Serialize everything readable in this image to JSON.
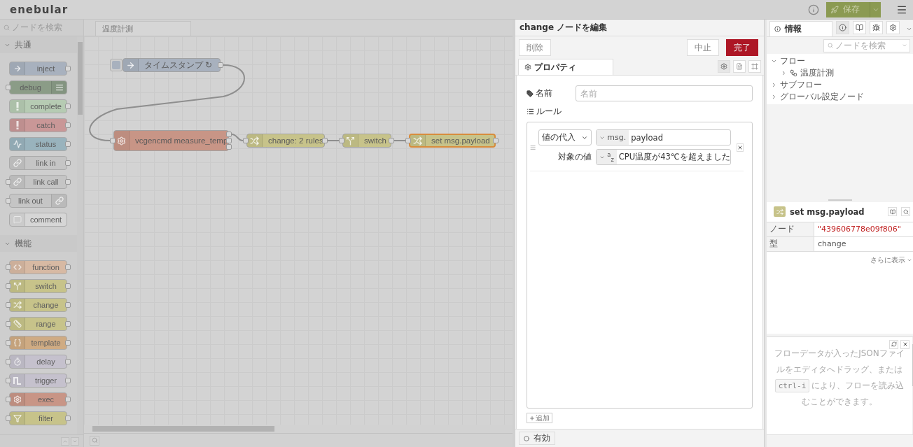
{
  "header": {
    "logo": "enebular",
    "deploy": {
      "label": "保存"
    }
  },
  "palette": {
    "search_placeholder": "ノードを検索",
    "categories": [
      {
        "title": "共通",
        "expanded": true,
        "nodes": [
          {
            "label": "inject",
            "kind": "inject",
            "color": "#a8b1be",
            "input": false,
            "output": true,
            "icon_right": false
          },
          {
            "label": "debug",
            "kind": "debug",
            "color": "#8b9c87",
            "input": true,
            "output": false,
            "icon_right": true
          },
          {
            "label": "complete",
            "kind": "alert",
            "color": "#b6cbb3",
            "input": false,
            "output": true,
            "icon_right": false
          },
          {
            "label": "catch",
            "kind": "alert",
            "color": "#c99797",
            "input": false,
            "output": true,
            "icon_right": false
          },
          {
            "label": "status",
            "kind": "status",
            "color": "#99b3bd",
            "input": false,
            "output": true,
            "icon_right": false
          },
          {
            "label": "link in",
            "kind": "link",
            "color": "#c5c5c5",
            "input": false,
            "output": true,
            "icon_right": false
          },
          {
            "label": "link call",
            "kind": "link",
            "color": "#c5c5c5",
            "input": true,
            "output": true,
            "icon_right": false
          },
          {
            "label": "link out",
            "kind": "link",
            "color": "#c5c5c5",
            "input": true,
            "output": false,
            "icon_right": true
          },
          {
            "label": "comment",
            "kind": "comment",
            "color": "#d6d6d6",
            "input": false,
            "output": false,
            "icon_right": false
          }
        ]
      },
      {
        "title": "機能",
        "expanded": true,
        "nodes": [
          {
            "label": "function",
            "kind": "function",
            "color": "#d7b9a3",
            "input": true,
            "output": true,
            "icon_right": false
          },
          {
            "label": "switch",
            "kind": "switch",
            "color": "#c7c38a",
            "input": true,
            "output": true,
            "icon_right": false
          },
          {
            "label": "change",
            "kind": "change",
            "color": "#c7c38a",
            "input": true,
            "output": true,
            "icon_right": false
          },
          {
            "label": "range",
            "kind": "range",
            "color": "#c7c38a",
            "input": true,
            "output": true,
            "icon_right": false
          },
          {
            "label": "template",
            "kind": "template",
            "color": "#cfab83",
            "input": true,
            "output": true,
            "icon_right": false
          },
          {
            "label": "delay",
            "kind": "delay",
            "color": "#c5c1cd",
            "input": true,
            "output": true,
            "icon_right": false
          },
          {
            "label": "trigger",
            "kind": "trigger",
            "color": "#c5c1cd",
            "input": true,
            "output": true,
            "icon_right": false
          },
          {
            "label": "exec",
            "kind": "exec",
            "color": "#c89586",
            "input": true,
            "output": true,
            "icon_right": false
          },
          {
            "label": "filter",
            "kind": "filter",
            "color": "#c7c38a",
            "input": true,
            "output": true,
            "icon_right": false
          }
        ]
      }
    ]
  },
  "workspace": {
    "tabs": [
      {
        "label": "温度計測",
        "selected": true
      }
    ],
    "nodes": [
      {
        "label": "タイムスタンプ ↻",
        "kind": "inject",
        "color": "#a8b1be",
        "input": false,
        "selected": false
      },
      {
        "label": "vcgencmd measure_temp",
        "kind": "exec",
        "color": "#c89586",
        "input": true,
        "selected": false
      },
      {
        "label": "change: 2 rules",
        "kind": "change",
        "color": "#c7c38a",
        "input": true,
        "selected": false
      },
      {
        "label": "switch",
        "kind": "switch",
        "color": "#c7c38a",
        "input": true,
        "selected": false
      },
      {
        "label": "set msg.payload",
        "kind": "change",
        "color": "#c7c38a",
        "input": true,
        "selected": true
      }
    ]
  },
  "editor": {
    "title": "change ノードを編集",
    "buttons": [
      {
        "label": "削除",
        "kind": "plain"
      },
      {
        "label": "中止",
        "kind": "plain"
      },
      {
        "label": "完了",
        "kind": "primary"
      }
    ],
    "tabs": [
      {
        "label": "プロパティ",
        "selected": true
      }
    ],
    "panel_buttons": [
      {
        "kind": "settings",
        "selected": true
      },
      {
        "kind": "document",
        "selected": false
      },
      {
        "kind": "frame",
        "selected": false
      }
    ],
    "name_field": {
      "label": "名前",
      "placeholder": "名前"
    },
    "rules_label": "ルール",
    "rules": [
      {
        "action": "値の代入",
        "target_prefix": "msg.",
        "target": "payload",
        "value_label": "対象の値",
        "value_type": "$^{a}$$_{z}$",
        "value": "CPU温度が43℃を超えました"
      }
    ],
    "add_button": "追加",
    "enabled_button": "有効"
  },
  "sidebar": {
    "tabs": [
      {
        "label": "情報",
        "selected": true
      }
    ],
    "tool_buttons": [
      {
        "kind": "info",
        "selected": true
      },
      {
        "kind": "book",
        "selected": false
      },
      {
        "kind": "bug",
        "selected": false
      },
      {
        "kind": "settings",
        "selected": false
      }
    ],
    "search_placeholder": "ノードを検索",
    "tree": [
      {
        "label": "フロー",
        "expanded": true,
        "children": [
          {
            "label": "温度計測",
            "expanded": false
          }
        ]
      },
      {
        "label": "サブフロー",
        "expanded": false
      },
      {
        "label": "グローバル設定ノード",
        "expanded": false
      }
    ],
    "info": {
      "title": "set msg.payload",
      "rows": [
        {
          "key": "ノード",
          "value": "\"439606778e09f806\"",
          "kind": "id"
        },
        {
          "key": "型",
          "value": "change",
          "kind": "text"
        }
      ],
      "more": "さらに表示"
    },
    "tip": {
      "before": "フローデータが入ったJSONファイルをエディタへドラッグ、または",
      "key": "ctrl-i",
      "after": "により、フローを読み込",
      "last": "むことができます。"
    }
  }
}
